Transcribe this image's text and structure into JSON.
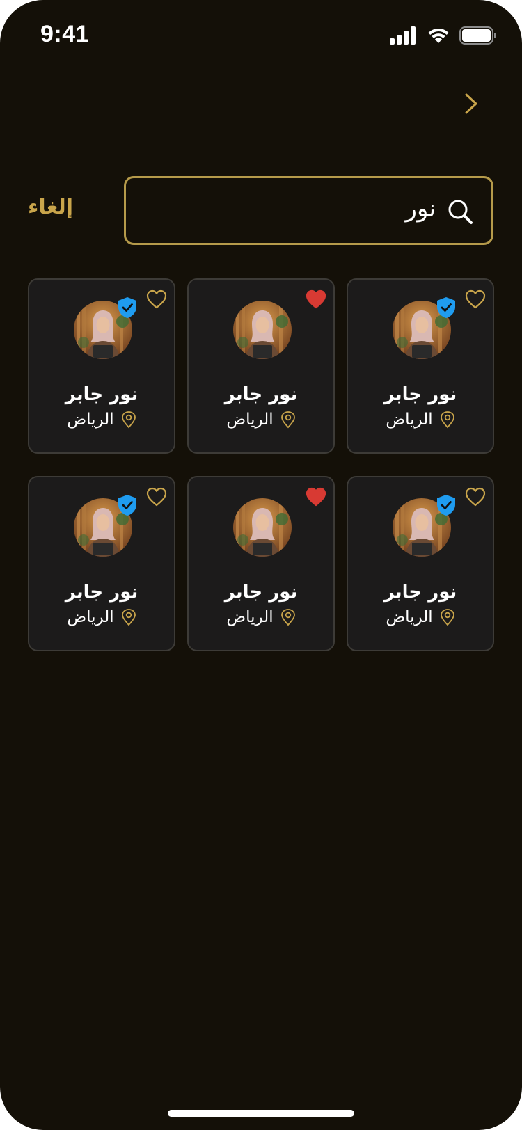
{
  "status_bar": {
    "time": "9:41"
  },
  "search": {
    "value": "نور",
    "cancel_label": "إلغاء"
  },
  "colors": {
    "accent": "#c9a54b",
    "background": "#141008",
    "card": "#1c1b1b",
    "verified": "#1f9cf0",
    "liked": "#d83a33"
  },
  "results": [
    {
      "name": "نور جابر",
      "city": "الرياض",
      "verified": true,
      "liked": false
    },
    {
      "name": "نور جابر",
      "city": "الرياض",
      "verified": false,
      "liked": true
    },
    {
      "name": "نور جابر",
      "city": "الرياض",
      "verified": true,
      "liked": false
    },
    {
      "name": "نور جابر",
      "city": "الرياض",
      "verified": true,
      "liked": false
    },
    {
      "name": "نور جابر",
      "city": "الرياض",
      "verified": false,
      "liked": true
    },
    {
      "name": "نور جابر",
      "city": "الرياض",
      "verified": true,
      "liked": false
    }
  ]
}
